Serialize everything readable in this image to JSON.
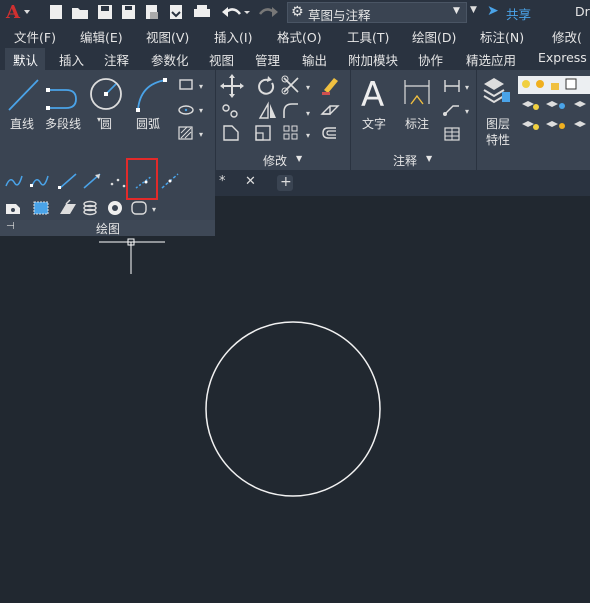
{
  "app": {
    "title_right": "Dr",
    "workspace": "草图与注释",
    "share": "共享"
  },
  "menu": [
    "文件(F)",
    "编辑(E)",
    "视图(V)",
    "插入(I)",
    "格式(O)",
    "工具(T)",
    "绘图(D)",
    "标注(N)",
    "修改("
  ],
  "ribbon_tabs": [
    "默认",
    "插入",
    "注释",
    "参数化",
    "视图",
    "管理",
    "输出",
    "附加模块",
    "协作",
    "精选应用",
    "Express T"
  ],
  "draw_panel": {
    "line": "直线",
    "polyline": "多段线",
    "circle": "圆",
    "arc": "圆弧",
    "title": "绘图"
  },
  "modify_panel": {
    "title": "修改"
  },
  "annotation_panel": {
    "text": "文字",
    "dimension": "标注",
    "title": "注释"
  },
  "layer_panel": {
    "label_line1": "图层",
    "label_line2": "特性"
  },
  "colors": {
    "highlight": "#e22a2a",
    "accent": "#4aa3e8",
    "canvas": "#212830",
    "ribbon": "#3a4452"
  },
  "icons": {
    "app": "autocad-logo-icon",
    "highlighted_tool": "construction-line-icon"
  }
}
